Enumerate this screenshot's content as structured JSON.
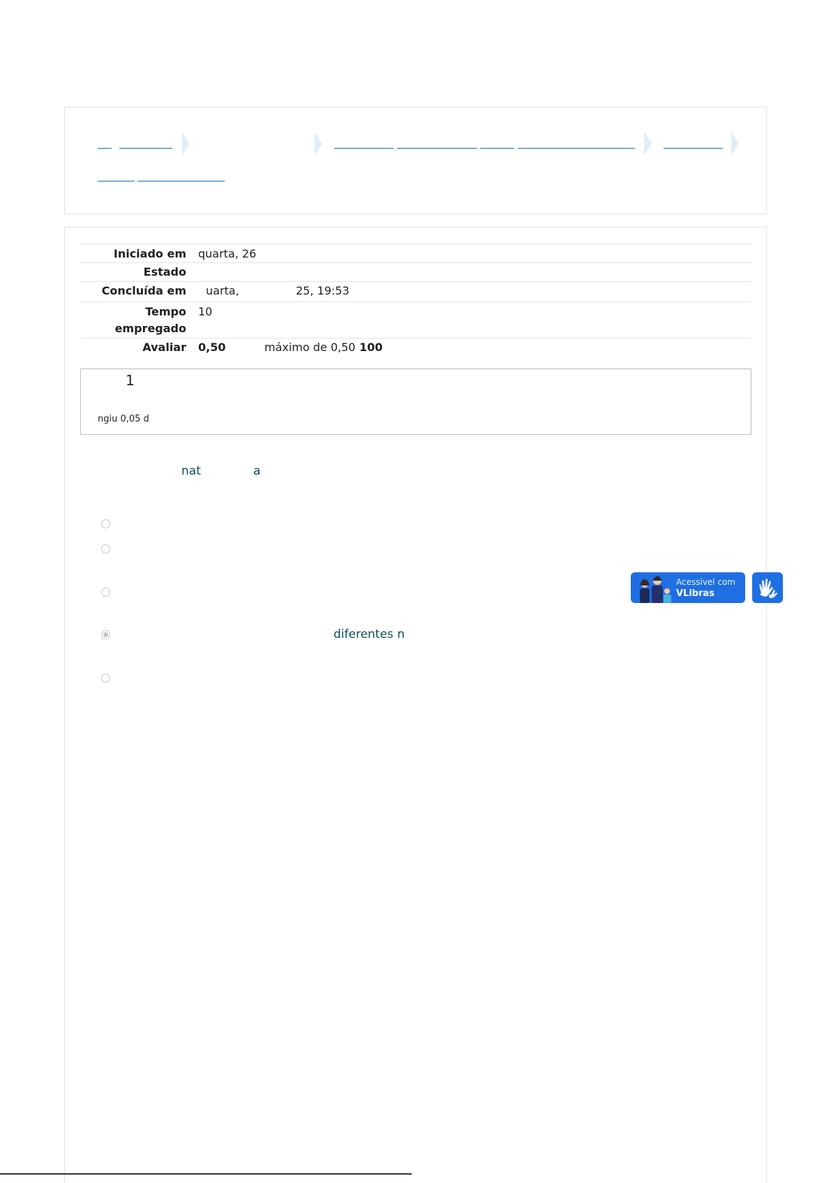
{
  "summary": {
    "rows": [
      {
        "key": "Iniciado em",
        "value": "quarta, 26"
      },
      {
        "key": "Estado",
        "value": ""
      },
      {
        "key": "Concluída em",
        "value": "uarta,",
        "value2": "25, 19:53"
      },
      {
        "key_line1": "Tempo",
        "key_line2": "empregado",
        "value": "10"
      },
      {
        "key": "Avaliar",
        "grade": "0,50",
        "max": "máximo de 0,50",
        "percent": "100"
      }
    ]
  },
  "question": {
    "number": "1",
    "mark_text": "ngiu 0,05 d",
    "text_frag1": "nat",
    "text_frag2": "a",
    "option_fragment": "diferentes n",
    "selected_option_index": 3
  },
  "vlibras": {
    "line1": "Acessível com",
    "line2": "VLibras"
  },
  "colors": {
    "link": "#0f6cbf",
    "question_text": "#0b4d55",
    "vlibras_blue": "#1f6fe2",
    "border": "#dee2e6"
  },
  "icons": [
    "chevron-right-icon",
    "radio-icon",
    "vlibras-avatars-icon",
    "sign-language-hand-icon"
  ]
}
